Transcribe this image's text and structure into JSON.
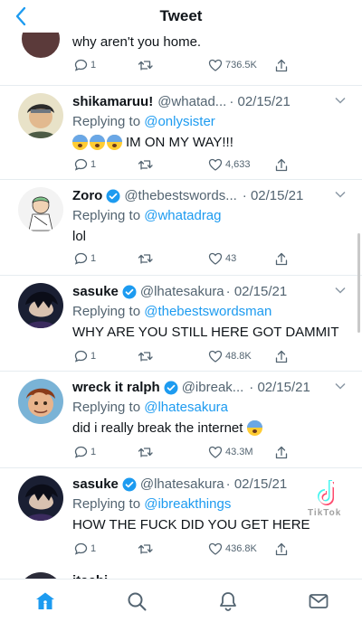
{
  "header": {
    "title": "Tweet"
  },
  "first_tweet_tail": {
    "text": "why aren't you home.",
    "replies": "1",
    "likes": "736.5K"
  },
  "tweets": [
    {
      "name": "shikamaruu!",
      "verified": false,
      "handle": "@whatad...",
      "date": "· 02/15/21",
      "reply_prefix": "Replying to ",
      "reply_to": "@onlysister",
      "text": "IM ON MY WAY!!!",
      "emoji_count": 3,
      "replies": "1",
      "likes": "4,633"
    },
    {
      "name": "Zoro",
      "verified": true,
      "handle": "@thebestswords...",
      "date": "· 02/15/21",
      "reply_prefix": "Replying to ",
      "reply_to": "@whatadrag",
      "text": "lol",
      "replies": "1",
      "likes": "43"
    },
    {
      "name": "sasuke",
      "verified": true,
      "handle": "@lhatesakura",
      "date": "· 02/15/21",
      "reply_prefix": "Replying to ",
      "reply_to": "@thebestswordsman",
      "text": "WHY ARE YOU STILL HERE GOT DAMMIT",
      "replies": "1",
      "likes": "48.8K"
    },
    {
      "name": "wreck it ralph",
      "verified": true,
      "handle": "@ibreak...",
      "date": "· 02/15/21",
      "reply_prefix": "Replying to ",
      "reply_to": "@lhatesakura",
      "text": "did i really break the internet",
      "emoji_count": 1,
      "replies": "1",
      "likes": "43.3M"
    },
    {
      "name": "sasuke",
      "verified": true,
      "handle": "@lhatesakura",
      "date": "· 02/15/21",
      "reply_prefix": "Replying to ",
      "reply_to": "@ibreakthings",
      "text": "HOW THE FUCK DID YOU GET HERE",
      "replies": "1",
      "likes": "436.8K"
    }
  ],
  "bottom_partial": {
    "name": "itachi"
  },
  "watermark": {
    "brand": "TikTok",
    "sub": ""
  },
  "tabs": [
    "home-icon",
    "search-icon",
    "notifications-icon",
    "messages-icon"
  ],
  "colors": {
    "accent": "#1d9bf0",
    "secondary_text": "#536471",
    "divider": "#e6ecf0"
  }
}
